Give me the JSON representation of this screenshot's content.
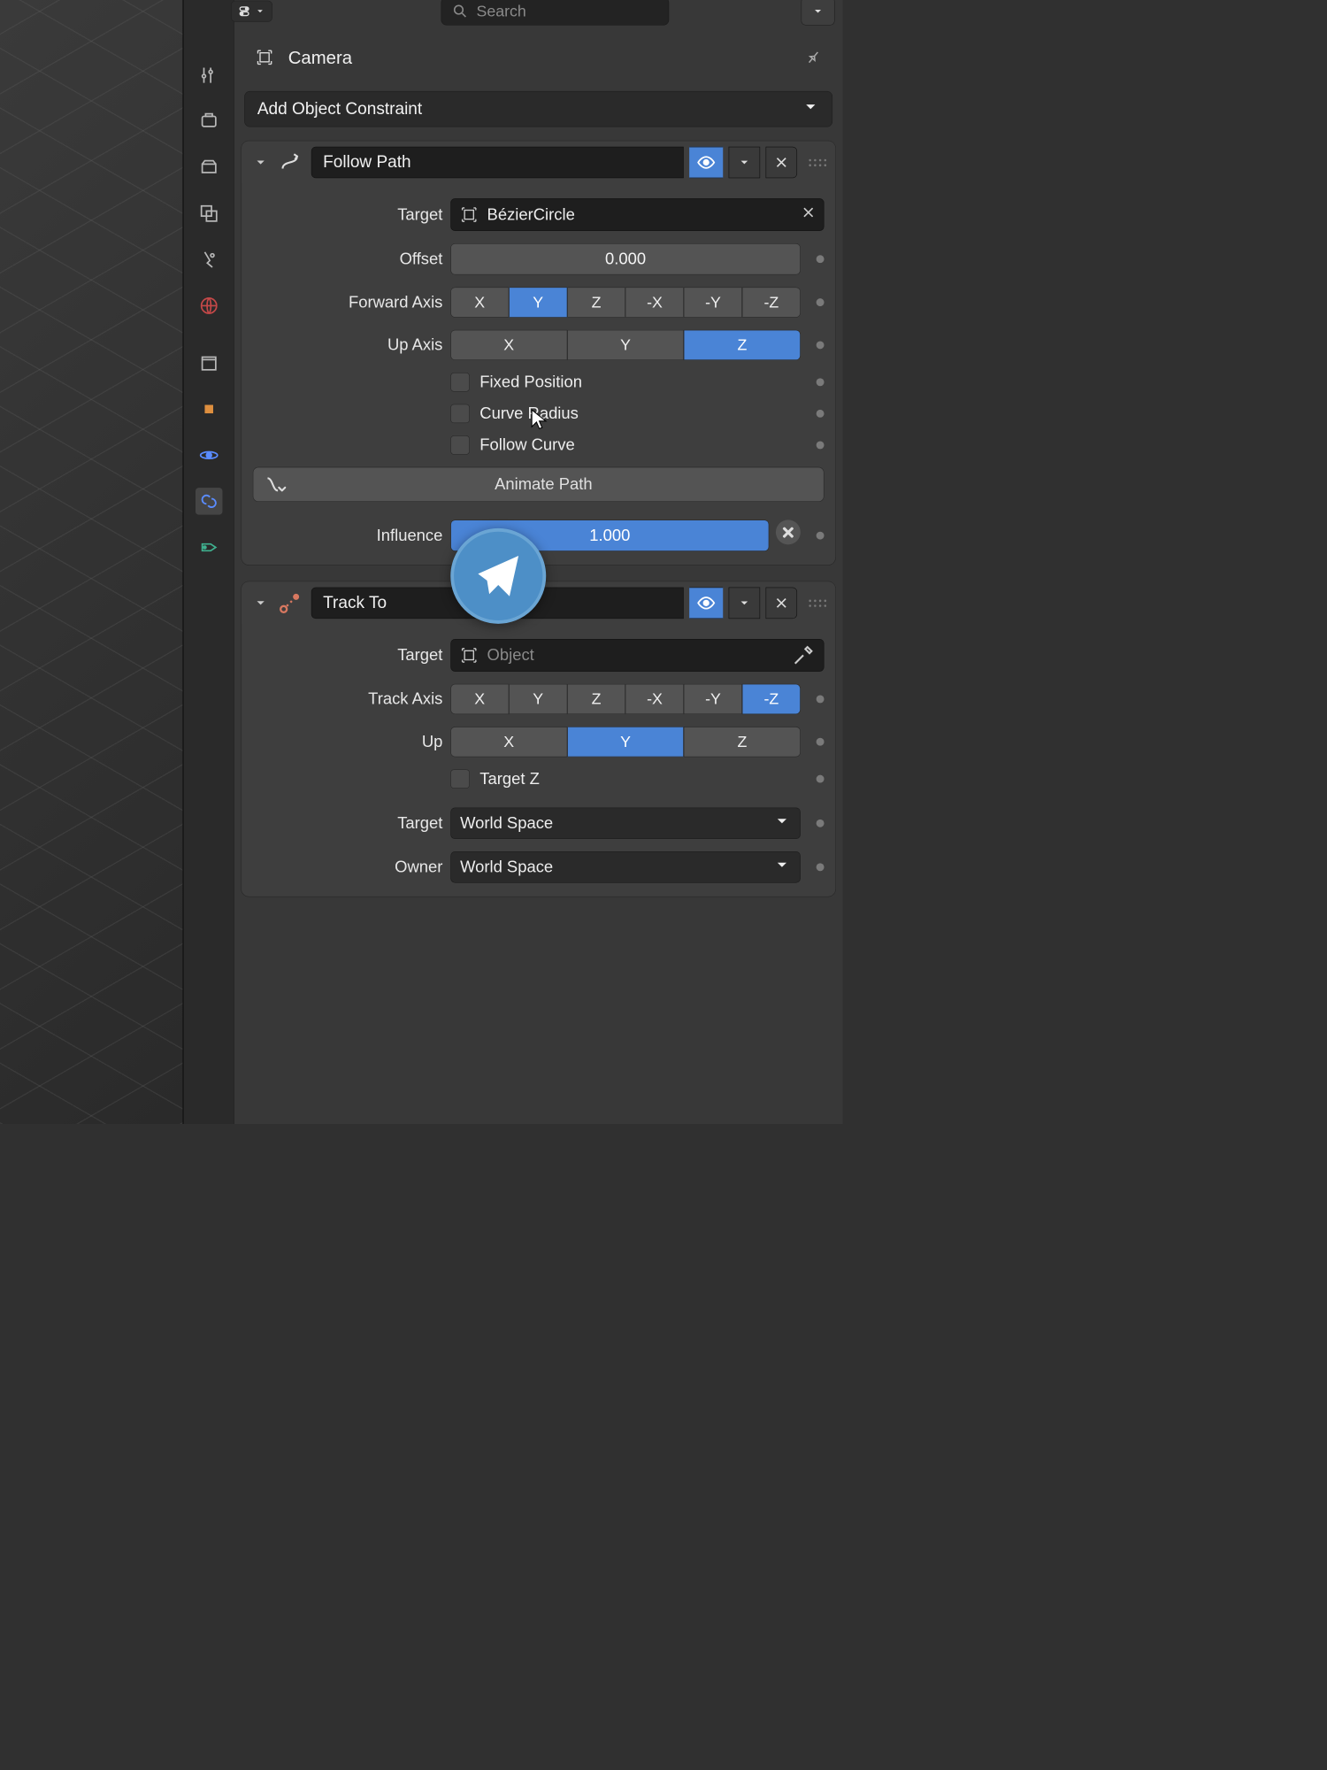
{
  "search_placeholder": "Search",
  "object_name": "Camera",
  "add_constraint_label": "Add Object Constraint",
  "axes6": [
    "X",
    "Y",
    "Z",
    "-X",
    "-Y",
    "-Z"
  ],
  "axes3": [
    "X",
    "Y",
    "Z"
  ],
  "constraints": {
    "follow_path": {
      "name": "Follow Path",
      "labels": {
        "target": "Target",
        "offset": "Offset",
        "forward_axis": "Forward Axis",
        "up_axis": "Up Axis",
        "fixed_position": "Fixed Position",
        "curve_radius": "Curve Radius",
        "follow_curve": "Follow Curve",
        "animate_path": "Animate Path",
        "influence": "Influence"
      },
      "target_value": "BézierCircle",
      "offset_value": "0.000",
      "forward_axis_selected": "Y",
      "up_axis_selected": "Z",
      "fixed_position": false,
      "curve_radius": false,
      "follow_curve": false,
      "influence_value": "1.000"
    },
    "track_to": {
      "name": "Track To",
      "labels": {
        "target": "Target",
        "track_axis": "Track Axis",
        "up_axis": "Up",
        "target_z": "Target Z",
        "target_space": "Target",
        "owner_space": "Owner"
      },
      "target_placeholder": "Object",
      "track_axis_selected": "-Z",
      "up_axis_selected": "Y",
      "target_z": false,
      "target_space_value": "World Space",
      "owner_space_value": "World Space"
    }
  }
}
